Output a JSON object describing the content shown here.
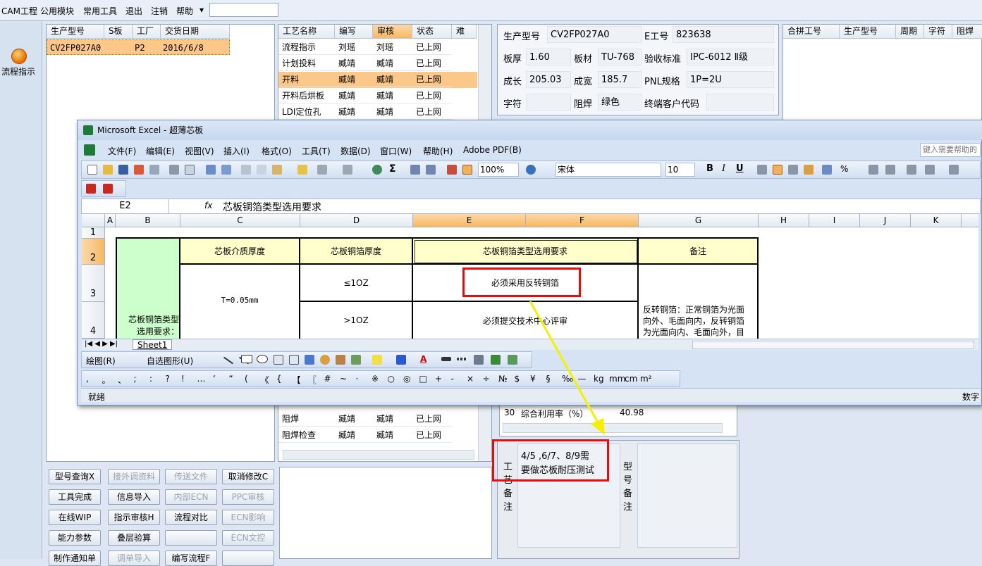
{
  "menubar": {
    "items": [
      "CAM工程",
      "公用模块",
      "常用工具",
      "退出",
      "注销",
      "帮助"
    ],
    "dropdown": "▾"
  },
  "leftbar": {
    "label": "流程指示"
  },
  "model_list": {
    "headers": [
      "生产型号",
      "S板",
      "工厂",
      "交货日期"
    ],
    "row": {
      "model": "CV2FP027A0",
      "s": "",
      "factory": "P2",
      "date": "2016/6/8"
    }
  },
  "process_list": {
    "headers": [
      "工艺名称",
      "编写",
      "审核",
      "状态",
      "难"
    ],
    "rows": [
      [
        "流程指示",
        "刘瑶",
        "刘瑶",
        "已上网"
      ],
      [
        "计划投料",
        "臧靖",
        "臧靖",
        "已上网"
      ],
      [
        "开料",
        "臧靖",
        "臧靖",
        "已上网"
      ],
      [
        "开料后烘板",
        "臧靖",
        "臧靖",
        "已上网"
      ],
      [
        "LDI定位孔",
        "臧靖",
        "臧靖",
        "已上网"
      ]
    ],
    "rows_bottom": [
      [
        "阻焊",
        "臧靖",
        "臧靖",
        "已上网"
      ],
      [
        "阻焊检查",
        "臧靖",
        "臧靖",
        "已上网"
      ]
    ]
  },
  "info": {
    "model_label": "生产型号",
    "model": "CV2FP027A0",
    "e_label": "E工号",
    "e": "823638",
    "thick_label": "板厚",
    "thick": "1.60",
    "mat_label": "板材",
    "mat": "TU-768",
    "std_label": "验收标准",
    "std": "IPC-6012 Ⅱ级",
    "len_label": "成长",
    "len": "205.03",
    "wid_label": "成宽",
    "wid": "185.7",
    "pnl_label": "PNL规格",
    "pnl": "1P=2U",
    "char_label": "字符",
    "char": "",
    "mask_label": "阻焊",
    "mask": "绿色",
    "cust_label": "终端客户代码",
    "cust": ""
  },
  "merge": {
    "headers": [
      "合拼工号",
      "生产型号",
      "周期",
      "字符",
      "阻焊"
    ]
  },
  "util_row": {
    "no": "30",
    "label": "综合利用率（%）",
    "value": "40.98"
  },
  "buttons": [
    [
      "型号查询X",
      "接外调资料",
      "传送文件",
      "取消修改C"
    ],
    [
      "工具完成",
      "信息导入",
      "内部ECN",
      "PPC审核"
    ],
    [
      "在线WIP",
      "指示审核H",
      "流程对比",
      "ECN影响"
    ],
    [
      "能力参数",
      "叠层验算",
      "",
      "ECN文控"
    ],
    [
      "制作通知单",
      "调单导入",
      "编写流程F",
      ""
    ]
  ],
  "buttons_disabled": [
    [
      false,
      true,
      true,
      false
    ],
    [
      false,
      false,
      true,
      true
    ],
    [
      false,
      false,
      false,
      true
    ],
    [
      false,
      false,
      false,
      true
    ],
    [
      false,
      true,
      false,
      false
    ]
  ],
  "notes": {
    "craft_label": "工艺备注",
    "craft_text_1": "4/5 ,6/7、8/9需",
    "craft_text_2": "要做芯板耐压测试",
    "model_label": "型号备注"
  },
  "excel": {
    "title": "Microsoft Excel - 超薄芯板",
    "menu": [
      "文件(F)",
      "编辑(E)",
      "视图(V)",
      "插入(I)",
      "格式(O)",
      "工具(T)",
      "数据(D)",
      "窗口(W)",
      "帮助(H)",
      "Adobe PDF(B)"
    ],
    "help_box": "键入需要帮助的",
    "zoom": "100%",
    "font": "宋体",
    "size": "10",
    "name_box": "E2",
    "fx": "fx",
    "formula": "芯板铜箔类型选用要求",
    "cols": [
      "A",
      "B",
      "C",
      "D",
      "E",
      "F",
      "G",
      "H",
      "I",
      "J",
      "K"
    ],
    "rows": [
      "1",
      "2",
      "3",
      "4"
    ],
    "cells": {
      "b_merged_1": "芯板铜箔类型",
      "b_merged_2": "选用要求：",
      "c2": "芯板介质厚度",
      "d2": "芯板铜箔厚度",
      "e2": "芯板铜箔类型选用要求",
      "g2": "备注",
      "c3": "T=0.05mm",
      "d3": "≤1OZ",
      "e3": "必须采用反转铜箔",
      "d4": ">1OZ",
      "e4": "必须提交技术中心评审",
      "g3_1": "反转铜箔：正常铜箔为光面",
      "g3_2": "向外、毛面向内，反转铜箔",
      "g3_3": "为光面向内、毛面向外，目"
    },
    "sheet_tab": "Sheet1",
    "draw_label": "绘图(R)",
    "autoshape": "自选图形(U)",
    "symbols": [
      ",",
      "。",
      "、",
      ";",
      ":",
      "?",
      "!",
      "…",
      "‘",
      "“",
      "(",
      "《",
      "{",
      "【",
      "〖",
      "#",
      "~",
      "·",
      "※",
      "○",
      "◎",
      "□",
      "+",
      "-",
      "×",
      "÷",
      "№",
      "$",
      "¥",
      "§",
      "‰",
      "—",
      "kg",
      "mm",
      "cm",
      "m²"
    ],
    "status": "就绪",
    "status_right": "数字"
  },
  "colors": {
    "highlight_red": "#e01010",
    "arrow_yellow": "#f4f000",
    "selected_row": "#fbc88a",
    "green_cell": "#ccffcc",
    "yellow_cell": "#ffffcc"
  }
}
